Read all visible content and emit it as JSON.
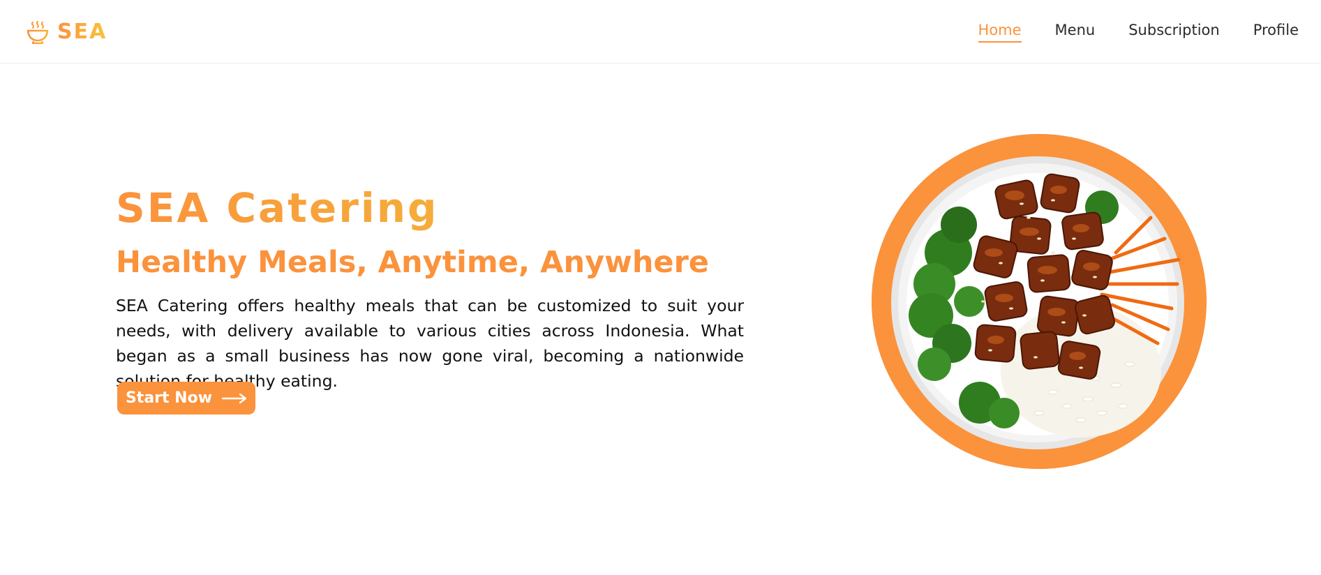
{
  "brand": {
    "name": "SEA",
    "icon": "bowl-steam-icon"
  },
  "nav": {
    "items": [
      {
        "label": "Home",
        "active": true
      },
      {
        "label": "Menu",
        "active": false
      },
      {
        "label": "Subscription",
        "active": false
      },
      {
        "label": "Profile",
        "active": false
      }
    ]
  },
  "hero": {
    "title": "SEA Catering",
    "subtitle": "Healthy Meals, Anytime, Anywhere",
    "description": "SEA Catering offers healthy meals that can be customized to suit your needs, with delivery available to various cities across Indonesia. What began as a small business has now gone viral, becoming a nationwide solution for healthy eating.",
    "cta_label": "Start Now",
    "cta_icon": "arrow-right-icon",
    "image_icon": "food-bowl-image"
  },
  "colors": {
    "accent": "#fb923c",
    "accent_gradient_end": "#f9c43a",
    "text": "#111111",
    "nav_text": "#2b2b2b"
  }
}
